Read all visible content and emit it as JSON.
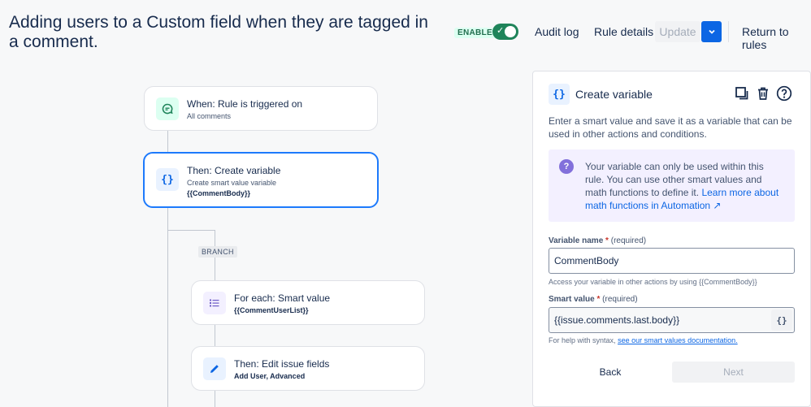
{
  "header": {
    "title": "Adding users to a Custom field when they are tagged in a comment.",
    "status_badge": "ENABLED",
    "audit_log": "Audit log",
    "rule_details": "Rule details",
    "update": "Update",
    "return": "Return to rules"
  },
  "flow": {
    "trigger": {
      "title": "When: Rule is triggered on",
      "subtitle": "All comments"
    },
    "create_var": {
      "title": "Then: Create variable",
      "subtitle": "Create smart value variable",
      "detail": "{{CommentBody}}"
    },
    "branch_label": "BRANCH",
    "for_each": {
      "title": "For each: Smart value",
      "detail": "{{CommentUserList}}"
    },
    "edit_fields": {
      "title": "Then: Edit issue fields",
      "detail": "Add User, Advanced"
    }
  },
  "panel": {
    "title": "Create variable",
    "description": "Enter a smart value and save it as a variable that can be used in other actions and conditions.",
    "info_text": "Your variable can only be used within this rule. You can use other smart values and math functions to define it.",
    "info_link": "Learn more about math functions in Automation ↗",
    "var_name_label": "Variable name",
    "required_mark": "*",
    "required_text": "(required)",
    "var_name_value": "CommentBody",
    "var_name_help": "Access your variable in other actions by using {{CommentBody}}",
    "smart_value_label": "Smart value",
    "smart_value_value": "{{issue.comments.last.body}}",
    "smart_value_btn": "{}",
    "syntax_help": "For help with syntax,",
    "syntax_link": "see our smart values documentation.",
    "back": "Back",
    "next": "Next"
  },
  "icons": {
    "var_icon": "{}"
  },
  "colors": {
    "accent": "#0c66e4",
    "enabled_green": "#1f845a",
    "selected_border": "#1d7afc",
    "info_bg": "#f3f0ff"
  }
}
